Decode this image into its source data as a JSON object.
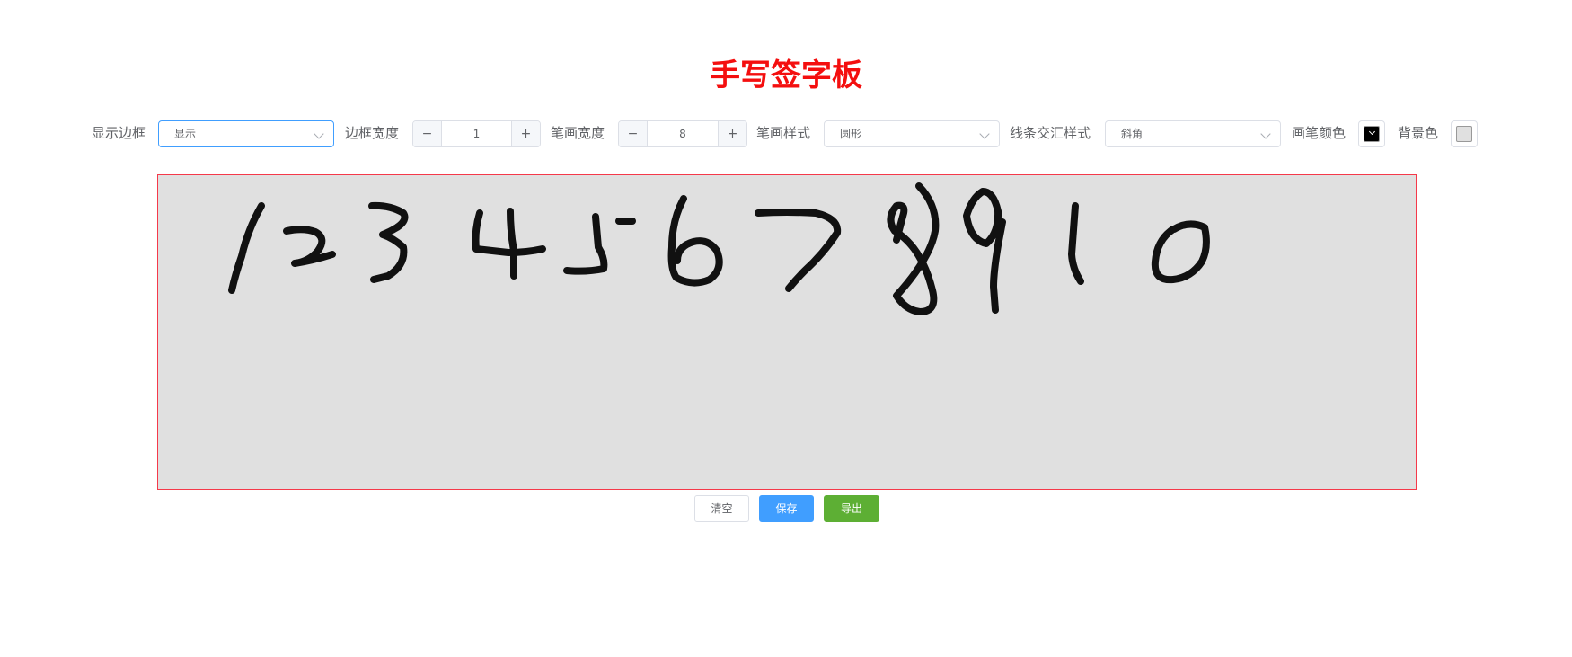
{
  "title": "手写签字板",
  "toolbar": {
    "show_border_label": "显示边框",
    "show_border_value": "显示",
    "border_width_label": "边框宽度",
    "border_width_value": "1",
    "stroke_width_label": "笔画宽度",
    "stroke_width_value": "8",
    "stroke_style_label": "笔画样式",
    "stroke_style_value": "圆形",
    "line_join_label": "线条交汇样式",
    "line_join_value": "斜角",
    "pen_color_label": "画笔颜色",
    "pen_color": "#000000",
    "bg_color_label": "背景色",
    "bg_color": "#e0e0e0",
    "minus_symbol": "−",
    "plus_symbol": "+"
  },
  "canvas": {
    "background": "#e0e0e0",
    "border_color": "#f5394a",
    "handwriting": "1 2 3 4 5 6 7 8 9 1 0"
  },
  "actions": {
    "clear_label": "清空",
    "save_label": "保存",
    "export_label": "导出"
  },
  "colors": {
    "title": "#f40f0f",
    "primary": "#409eff",
    "success": "#5daf34"
  }
}
